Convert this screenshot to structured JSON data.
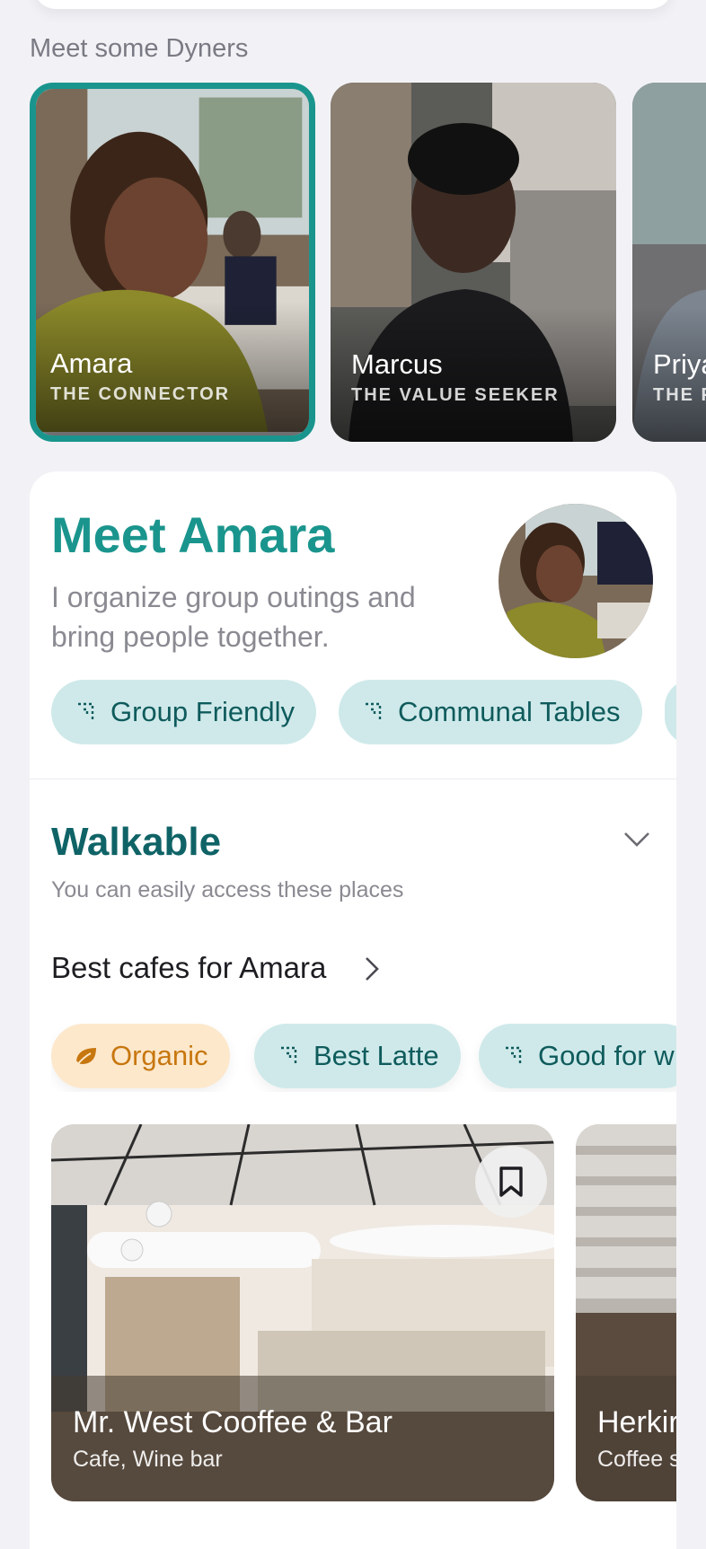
{
  "section_label": "Meet some Dyners",
  "personas": [
    {
      "name": "Amara",
      "role": "THE CONNECTOR",
      "selected": true
    },
    {
      "name": "Marcus",
      "role": "THE VALUE SEEKER",
      "selected": false
    },
    {
      "name": "Priya",
      "role": "THE P",
      "selected": false
    }
  ],
  "profile": {
    "title": "Meet Amara",
    "description": "I organize group outings and bring people together.",
    "chips": [
      "Group Friendly",
      "Communal Tables"
    ]
  },
  "walkable": {
    "title": "Walkable",
    "subtitle": "You can easily access these places",
    "best_title": "Best cafes for Amara"
  },
  "filters": [
    {
      "label": "Organic",
      "style": "orange",
      "icon": "leaf-icon"
    },
    {
      "label": "Best Latte",
      "style": "teal",
      "icon": "tag-icon"
    },
    {
      "label": "Good for w",
      "style": "teal",
      "icon": "tag-icon"
    }
  ],
  "venues": [
    {
      "name": "Mr. West Cooffee & Bar",
      "type": "Cafe, Wine bar"
    },
    {
      "name": "Herkir",
      "type": "Coffee s"
    }
  ],
  "colors": {
    "accent": "#1a958d",
    "accent_dark": "#0f6366",
    "chip_bg": "#cfe9ea",
    "orange": "#c7770f"
  }
}
